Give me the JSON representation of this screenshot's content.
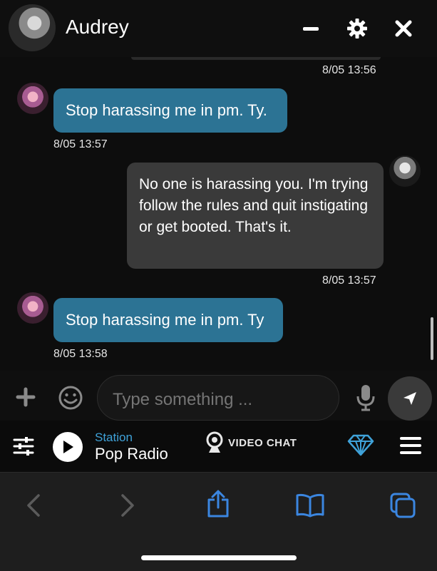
{
  "header": {
    "title": "Audrey",
    "buttons": [
      "minimize-icon",
      "gear-icon",
      "close-icon"
    ]
  },
  "messages": [
    {
      "direction": "out",
      "timestamp": "8/05 13:56"
    },
    {
      "direction": "in",
      "text": "Stop harassing me in pm. Ty.",
      "timestamp": "8/05 13:57"
    },
    {
      "direction": "out",
      "text": "No one is harassing you. I'm trying follow the rules and quit instigating or get booted. That's it.",
      "timestamp": "8/05 13:57"
    },
    {
      "direction": "in",
      "text": "Stop harassing me in pm. Ty",
      "timestamp": "8/05 13:58"
    }
  ],
  "composer": {
    "placeholder": "Type something ...",
    "icons": [
      "plus-icon",
      "emoji-icon",
      "microphone-icon",
      "send-icon"
    ]
  },
  "player": {
    "station_label": "Station",
    "station_name": "Pop Radio",
    "video_chat_label": "VIDEO CHAT",
    "icons": [
      "equalizer-icon",
      "play-icon",
      "webcam-icon",
      "diamond-icon",
      "menu-icon"
    ]
  },
  "toolbar": {
    "icons": [
      "back-icon",
      "forward-icon",
      "share-icon",
      "bookmarks-icon",
      "tabs-icon"
    ]
  },
  "colors": {
    "incoming_bubble": "#2c7394",
    "outgoing_bubble": "#3a3a3a",
    "accent": "#3fa2d9",
    "safari_blue": "#3b86e0"
  }
}
